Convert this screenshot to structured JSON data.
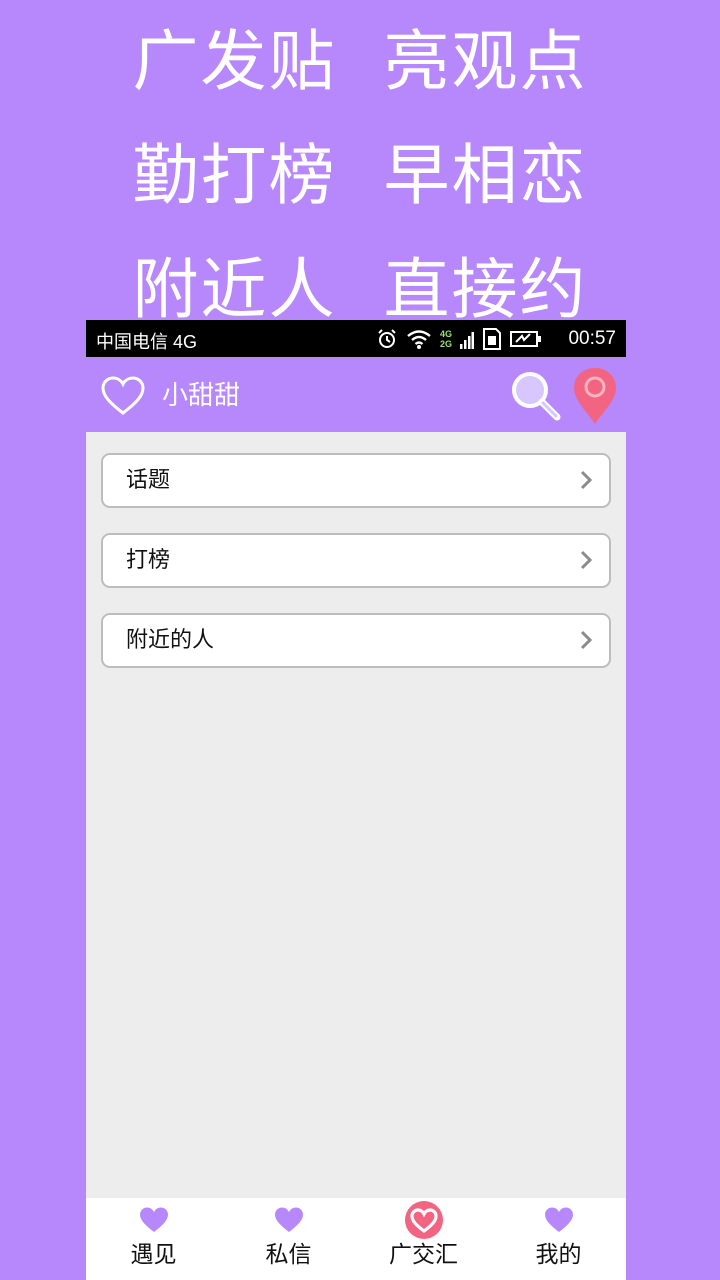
{
  "promo": {
    "line1": "广发贴 亮观点",
    "line2": "勤打榜 早相恋",
    "line3": "附近人 直接约"
  },
  "status_bar": {
    "carrier": "中国电信 4G",
    "network_top": "4G",
    "network_bottom": "2G",
    "time": "00:57"
  },
  "app_bar": {
    "title": "小甜甜",
    "icons": [
      "heart-outline-icon",
      "search-icon",
      "location-pin-icon"
    ]
  },
  "menu": {
    "items": [
      {
        "label": "话题"
      },
      {
        "label": "打榜"
      },
      {
        "label": "附近的人"
      }
    ]
  },
  "tabs": {
    "items": [
      {
        "label": "遇见",
        "icon": "heart-icon"
      },
      {
        "label": "私信",
        "icon": "heart-icon"
      },
      {
        "label": "广交汇",
        "icon": "heart-circle-icon"
      },
      {
        "label": "我的",
        "icon": "heart-icon"
      }
    ],
    "active_index": 2
  },
  "colors": {
    "background": "#b788fc",
    "content": "#ededed",
    "accent_pink": "#f26582",
    "heart_purple": "#b788fc"
  }
}
